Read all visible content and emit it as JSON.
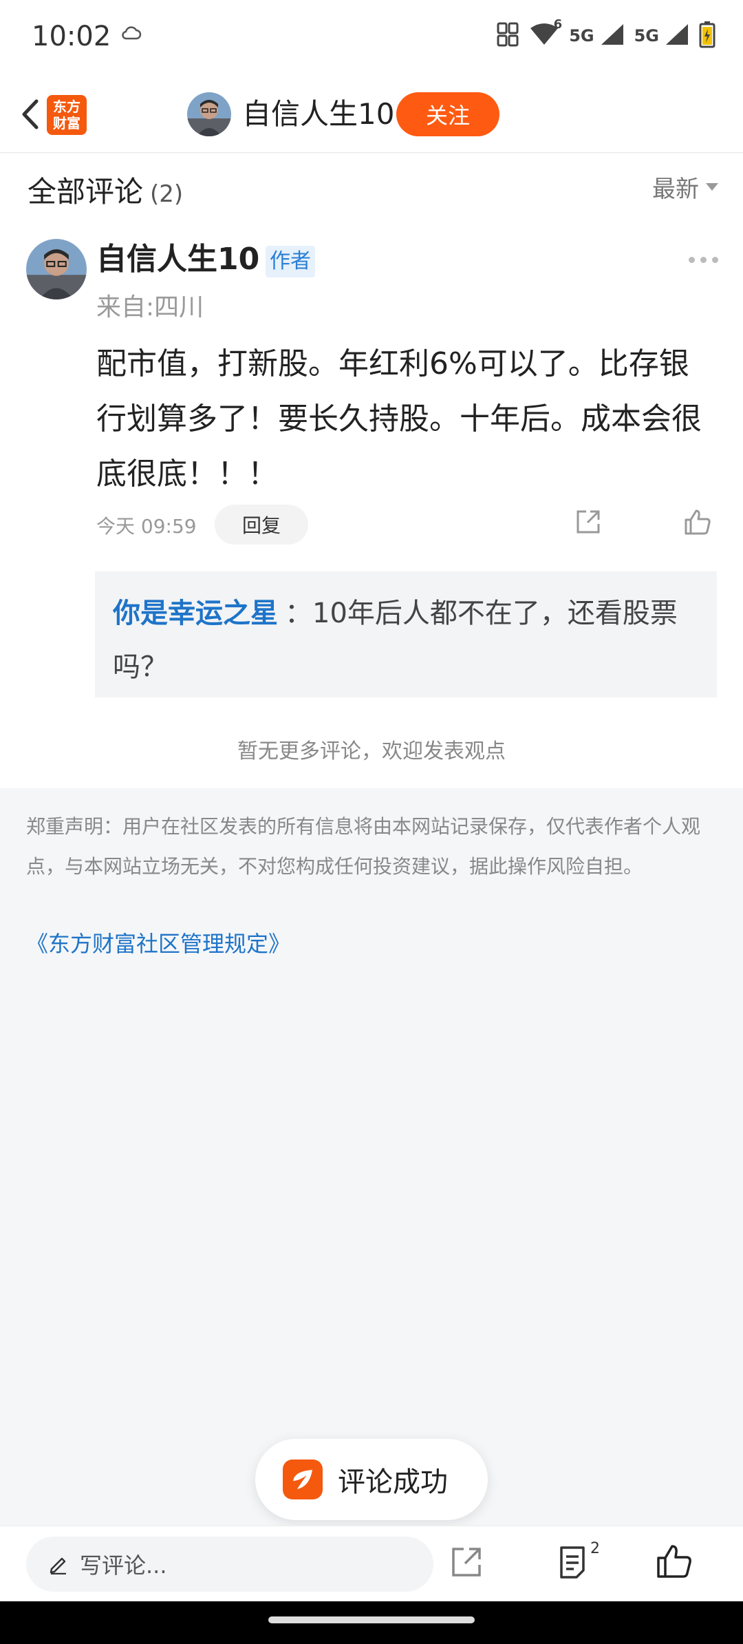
{
  "status": {
    "time": "10:02",
    "network_1": "5G",
    "network_2": "5G",
    "wifi_sup": "6"
  },
  "nav": {
    "app_logo_text": "东方财富",
    "user_name": "自信人生10",
    "follow_label": "关注"
  },
  "comments_header": {
    "title": "全部评论",
    "count": "(2)",
    "sort_label": "最新"
  },
  "comment": {
    "user": "自信人生10",
    "tag": "作者",
    "from": "来自:四川",
    "text": "配市值，打新股。年红利6%可以了。比存银行划算多了！要长久持股。十年后。成本会很底很底！！！",
    "time": "今天 09:59",
    "reply_label": "回复",
    "reply": {
      "user": "你是幸运之星",
      "text": "：10年后人都不在了，还看股票吗？"
    }
  },
  "no_more": "暂无更多评论，欢迎发表观点",
  "disclaimer": "郑重声明：用户在社区发表的所有信息将由本网站记录保存，仅代表作者个人观点，与本网站立场无关，不对您构成任何投资建议，据此操作风险自担。",
  "rules_link": "《东方财富社区管理规定》",
  "toast": {
    "text": "评论成功"
  },
  "bottom_bar": {
    "placeholder": "写评论...",
    "comment_count": "2"
  },
  "colors": {
    "accent": "#ff5a12",
    "link": "#1e74c8",
    "background": "#f5f6f8"
  }
}
